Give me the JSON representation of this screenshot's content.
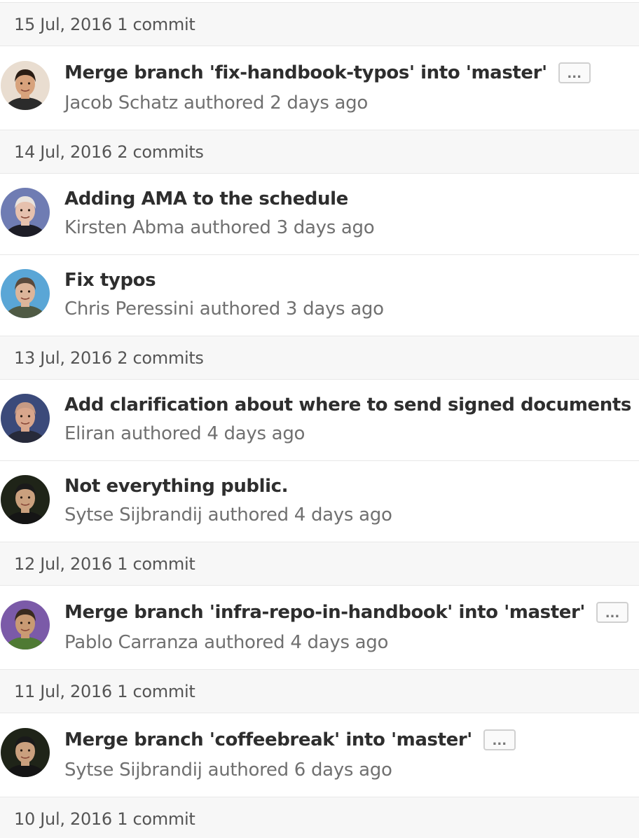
{
  "days": [
    {
      "date": "15 Jul, 2016",
      "count": "1 commit",
      "commits": [
        {
          "title": "Merge branch 'fix-handbook-typos' into 'master'",
          "has_ellipsis": true,
          "author": "Jacob Schatz",
          "authored": "authored",
          "time": "2 days ago",
          "avatar": {
            "bg": "#e9ddd0",
            "hair": "#2a1d14",
            "skin": "#d7a27c",
            "shirt": "#2b2b2b"
          }
        }
      ]
    },
    {
      "date": "14 Jul, 2016",
      "count": "2 commits",
      "commits": [
        {
          "title": "Adding AMA to the schedule",
          "has_ellipsis": false,
          "author": "Kirsten Abma",
          "authored": "authored",
          "time": "3 days ago",
          "avatar": {
            "bg": "#6f7cb3",
            "hair": "#e9e3dd",
            "skin": "#e6c1ae",
            "shirt": "#1d1d26"
          }
        },
        {
          "title": "Fix typos",
          "has_ellipsis": false,
          "author": "Chris Peressini",
          "authored": "authored",
          "time": "3 days ago",
          "avatar": {
            "bg": "#5aa6d6",
            "hair": "#5a4a3c",
            "skin": "#dcb59a",
            "shirt": "#4f5a44"
          }
        }
      ]
    },
    {
      "date": "13 Jul, 2016",
      "count": "2 commits",
      "commits": [
        {
          "title": "Add clarification about where to send signed documents",
          "has_ellipsis": false,
          "author": "Eliran",
          "authored": "authored",
          "time": "4 days ago",
          "avatar": {
            "bg": "#3b4a7a",
            "hair": "#c69a84",
            "skin": "#d8a68c",
            "shirt": "#272a3a"
          }
        },
        {
          "title": "Not everything public.",
          "has_ellipsis": false,
          "author": "Sytse Sijbrandij",
          "authored": "authored",
          "time": "4 days ago",
          "avatar": {
            "bg": "#1f2418",
            "hair": "#1a1a1a",
            "skin": "#caa07e",
            "shirt": "#151515"
          }
        }
      ]
    },
    {
      "date": "12 Jul, 2016",
      "count": "1 commit",
      "commits": [
        {
          "title": "Merge branch 'infra-repo-in-handbook' into 'master'",
          "has_ellipsis": true,
          "author": "Pablo Carranza",
          "authored": "authored",
          "time": "4 days ago",
          "avatar": {
            "bg": "#7b5aa8",
            "hair": "#3a2b1f",
            "skin": "#c99a73",
            "shirt": "#4f7a34"
          }
        }
      ]
    },
    {
      "date": "11 Jul, 2016",
      "count": "1 commit",
      "commits": [
        {
          "title": "Merge branch 'coffeebreak' into 'master'",
          "has_ellipsis": true,
          "author": "Sytse Sijbrandij",
          "authored": "authored",
          "time": "6 days ago",
          "avatar": {
            "bg": "#1f2418",
            "hair": "#1a1a1a",
            "skin": "#caa07e",
            "shirt": "#151515"
          }
        }
      ]
    },
    {
      "date": "10 Jul, 2016",
      "count": "1 commit",
      "commits": []
    }
  ],
  "ellipsis_label": "..."
}
